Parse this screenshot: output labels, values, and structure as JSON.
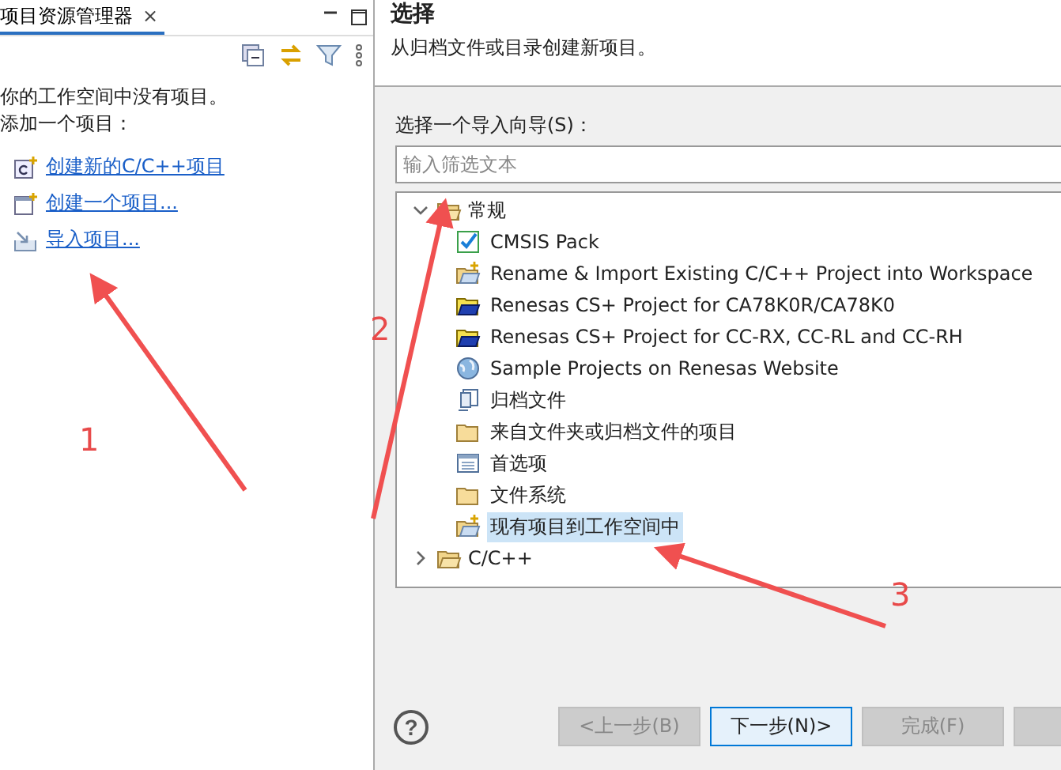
{
  "explorer": {
    "tab_title": "项目资源管理器",
    "tab_close": "×",
    "message_lines": [
      "你的工作空间中没有项目。",
      "添加一个项目："
    ],
    "links": [
      {
        "kind": "cproject",
        "label": "创建新的C/C++项目"
      },
      {
        "kind": "project",
        "label": "创建一个项目..."
      },
      {
        "kind": "import",
        "label": "导入项目..."
      }
    ]
  },
  "dialog": {
    "title": "选择",
    "description": "从归档文件或目录创建新项目。",
    "wizard_label": "选择一个导入向导(S)：",
    "filter": {
      "placeholder": "输入筛选文本"
    },
    "tree": [
      {
        "label": "常规",
        "expanded": true,
        "children": [
          {
            "kind": "checkbox",
            "label": "CMSIS Pack",
            "selected": false
          },
          {
            "kind": "import",
            "label": "Rename & Import Existing C/C++ Project into Workspace",
            "selected": false
          },
          {
            "kind": "renesas",
            "label": "Renesas CS+ Project for CA78K0R/CA78K0",
            "selected": false
          },
          {
            "kind": "renesas",
            "label": "Renesas CS+ Project for CC-RX, CC-RL and CC-RH",
            "selected": false
          },
          {
            "kind": "globe",
            "label": "Sample Projects on Renesas Website",
            "selected": false
          },
          {
            "kind": "archive",
            "label": "归档文件",
            "selected": false
          },
          {
            "kind": "folder",
            "label": "来自文件夹或归档文件的项目",
            "selected": false
          },
          {
            "kind": "preferences",
            "label": "首选项",
            "selected": false
          },
          {
            "kind": "folder",
            "label": "文件系统",
            "selected": false
          },
          {
            "kind": "import",
            "label": "现有项目到工作空间中",
            "selected": true
          }
        ]
      },
      {
        "label": "C/C++",
        "expanded": false
      }
    ],
    "help": "?",
    "buttons": [
      {
        "label": "<上一步(B)",
        "disabled": true,
        "default": false
      },
      {
        "label": "下一步(N)>",
        "disabled": false,
        "default": true
      },
      {
        "label": "完成(F)",
        "disabled": true,
        "default": false
      },
      {
        "disabled": true,
        "default": false
      }
    ]
  },
  "annotations": [
    {
      "number": "1"
    },
    {
      "number": "2"
    },
    {
      "number": "3"
    }
  ]
}
